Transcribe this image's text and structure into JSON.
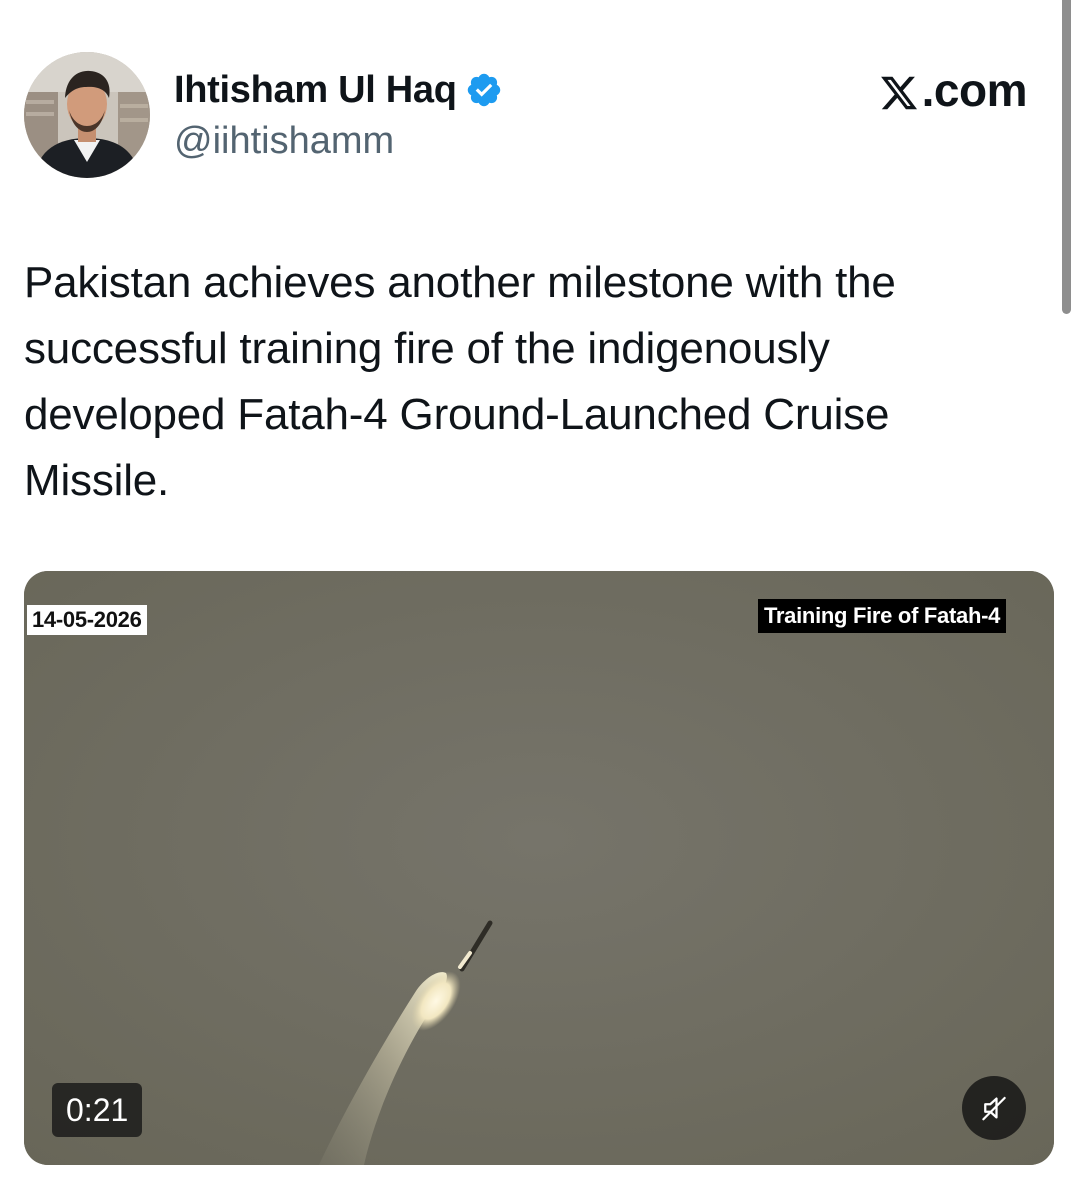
{
  "author": {
    "display_name": "Ihtisham Ul Haq",
    "handle": "@iihtishamm",
    "verified_icon": "verified-badge-icon"
  },
  "brand": {
    "label": ".com",
    "icon": "x-logo-icon"
  },
  "tweet": {
    "text": "Pakistan achieves another milestone with the successful training fire of the indigenously developed Fatah-4 Ground-Launched Cruise Missile."
  },
  "media": {
    "date_overlay": "14-05-2026",
    "title_overlay": "Training Fire of Fatah-4",
    "duration": "0:21",
    "mute_icon": "speaker-muted-icon"
  },
  "colors": {
    "verified_blue": "#1d9bf0",
    "text_primary": "#0f1419",
    "text_secondary": "#536471",
    "video_sky": "#6f6d5e"
  }
}
